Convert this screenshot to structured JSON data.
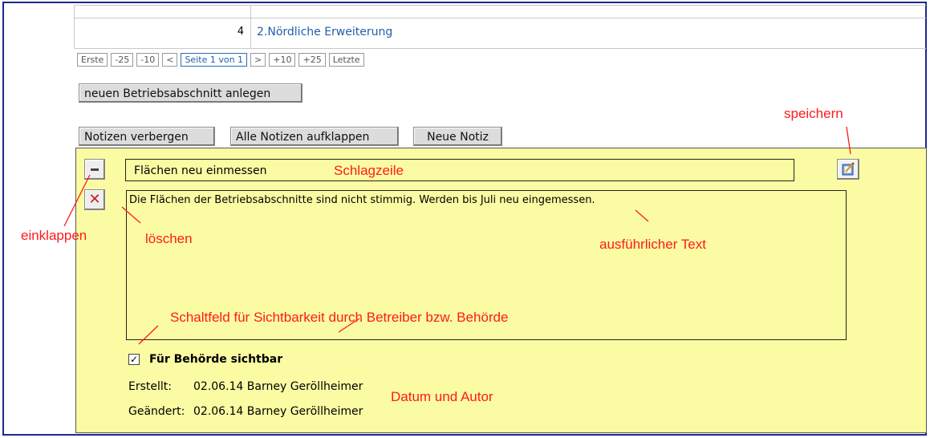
{
  "table": {
    "row": {
      "number": "4",
      "name": "2.Nördliche Erweiterung"
    }
  },
  "pager": {
    "items": [
      "Erste",
      "-25",
      "-10",
      "<",
      "Seite 1 von 1",
      ">",
      "+10",
      "+25",
      "Letzte"
    ],
    "current_index": 4
  },
  "buttons": {
    "new_section": "neuen Betriebsabschnitt anlegen",
    "hide_notes": "Notizen verbergen",
    "expand_all": "Alle Notizen aufklappen",
    "new_note": "Neue Notiz"
  },
  "note": {
    "headline": "Flächen neu einmessen",
    "text": "Die Flächen der Betriebsabschnitte sind nicht stimmig. Werden bis Juli neu eingemessen.",
    "visibility_label": "Für Behörde sichtbar",
    "visibility_checked": true,
    "created_label": "Erstellt:",
    "created_value": "02.06.14  Barney Geröllheimer",
    "modified_label": "Geändert:",
    "modified_value": "02.06.14  Barney Geröllheimer",
    "delete_glyph": "✕",
    "check_glyph": "✓"
  },
  "annotations": {
    "save": "speichern",
    "headline": "Schlagzeile",
    "collapse": "einklappen",
    "delete": "löschen",
    "detail_text": "ausführlicher Text",
    "visibility": "Schaltfeld für Sichtbarkeit durch Betreiber bzw. Behörde",
    "date_author": "Datum und Autor"
  },
  "colors": {
    "note_background": "#fbfba3",
    "annotation": "#ff1a1a",
    "link": "#1f5fa8",
    "frame": "#1a2a8c"
  },
  "icons": {
    "collapse": "minus-icon",
    "delete": "close-icon",
    "save": "save-edit-icon"
  }
}
